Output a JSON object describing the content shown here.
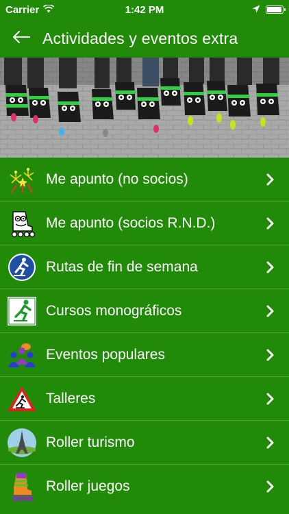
{
  "status_bar": {
    "carrier": "Carrier",
    "time": "1:42 PM",
    "battery_level": 0.95,
    "wifi_icon": "wifi-icon",
    "location_icon": "location-arrow-icon",
    "battery_icon": "battery-icon"
  },
  "nav": {
    "title": "Actividades y eventos extra",
    "back_icon": "back-arrow-icon"
  },
  "colors": {
    "background": "#218a09",
    "text": "#ffffff"
  },
  "menu": {
    "items": [
      {
        "label": "Me apunto (no socios)",
        "icon": "fireworks-icon"
      },
      {
        "label": "Me apunto (socios R.N.D.)",
        "icon": "skate-character-icon"
      },
      {
        "label": "Rutas de fin de semana",
        "icon": "skater-circle-icon"
      },
      {
        "label": "Cursos monográficos",
        "icon": "skater-sign-icon"
      },
      {
        "label": "Eventos populares",
        "icon": "people-group-icon"
      },
      {
        "label": "Talleres",
        "icon": "warning-skater-icon"
      },
      {
        "label": "Roller turismo",
        "icon": "eiffel-tower-icon"
      },
      {
        "label": "Roller juegos",
        "icon": "inline-skate-icon"
      }
    ]
  }
}
